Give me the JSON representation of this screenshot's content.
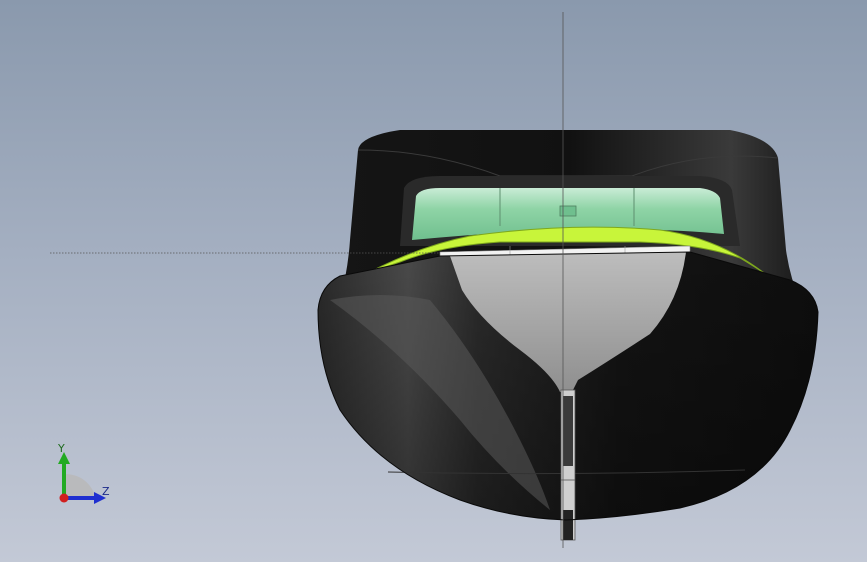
{
  "viewport": {
    "background_top": "#8a99ad",
    "background_bottom": "#c3c9d6"
  },
  "model": {
    "hull_color": "#1a1a1a",
    "deck_gray": "#9a9a9a",
    "windshield_color": "#8fd4a6",
    "trim_color": "#c8f53a"
  },
  "triad": {
    "y_label": "Y",
    "z_label": "Z",
    "y_color": "#22aa22",
    "z_color": "#1f2fd0",
    "x_color": "#d01f1f"
  }
}
